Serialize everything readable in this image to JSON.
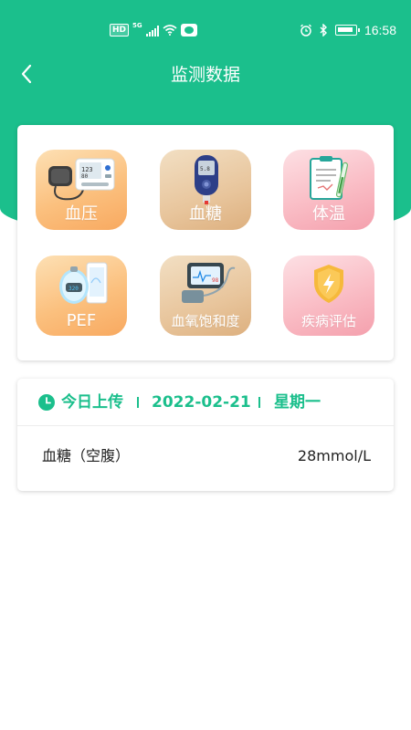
{
  "status_bar": {
    "left_badges": [
      "HD",
      "5G"
    ],
    "time": "16:58",
    "icons": [
      "signal-icon",
      "wifi-icon",
      "app-notification-icon",
      "alarm-icon",
      "bluetooth-icon",
      "battery-icon"
    ]
  },
  "header": {
    "title": "监测数据",
    "back_icon": "chevron-left-icon"
  },
  "colors": {
    "brand": "#1bbf8c",
    "tile_orange": "#fbc07e",
    "tile_tan": "#e8c59c",
    "tile_pink": "#f9b9c2"
  },
  "tiles": [
    {
      "label": "血压",
      "icon": "blood-pressure-monitor-icon"
    },
    {
      "label": "血糖",
      "icon": "glucose-meter-icon"
    },
    {
      "label": "体温",
      "icon": "thermometer-clipboard-icon"
    },
    {
      "label": "PEF",
      "icon": "peak-flow-meter-icon"
    },
    {
      "label": "血氧饱和度",
      "icon": "pulse-oximeter-icon"
    },
    {
      "label": "疾病评估",
      "icon": "shield-bolt-icon"
    }
  ],
  "upload": {
    "title": "今日上传",
    "date": "2022-02-21",
    "weekday": "星期一",
    "records": [
      {
        "name": "血糖（空腹）",
        "value": "28mmol/L"
      }
    ]
  }
}
